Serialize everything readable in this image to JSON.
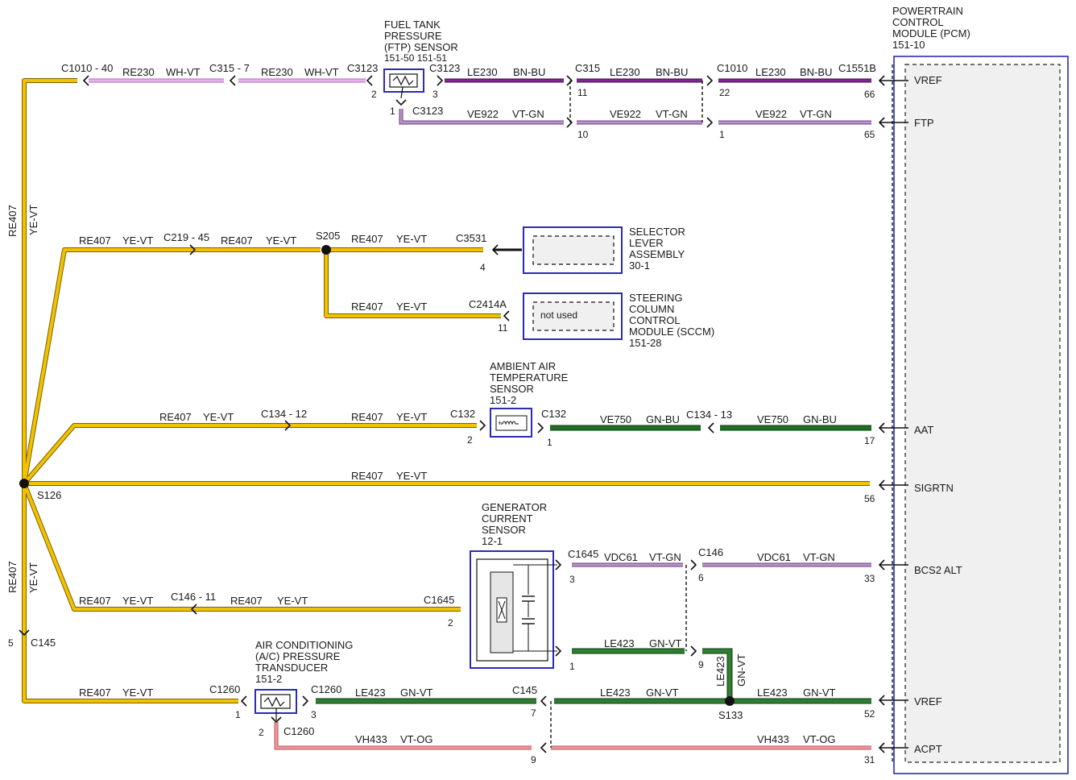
{
  "pcm": {
    "name_lines": [
      "POWERTRAIN",
      "CONTROL",
      "MODULE (PCM)",
      "151-10"
    ],
    "signals": {
      "vref1": {
        "name": "VREF",
        "pin": "66"
      },
      "ftp": {
        "name": "FTP",
        "pin": "65"
      },
      "aat": {
        "name": "AAT",
        "pin": "17"
      },
      "sigrtn": {
        "name": "SIGRTN",
        "pin": "56"
      },
      "bcs2alt": {
        "name": "BCS2 ALT",
        "pin": "33"
      },
      "vref2": {
        "name": "VREF",
        "pin": "52"
      },
      "acpt": {
        "name": "ACPT",
        "pin": "31"
      }
    }
  },
  "components": {
    "ftp_sensor": {
      "name_lines": [
        "FUEL TANK",
        "PRESSURE",
        "(FTP) SENSOR"
      ],
      "ref": "151-50  151-51"
    },
    "selector": {
      "name_lines": [
        "SELECTOR",
        "LEVER",
        "ASSEMBLY",
        "30-1"
      ]
    },
    "sccm": {
      "name_lines": [
        "STEERING",
        "COLUMN",
        "CONTROL",
        "MODULE (SCCM)",
        "151-28"
      ],
      "inner_text": "not used"
    },
    "aat_sensor": {
      "name_lines": [
        "AMBIENT AIR",
        "TEMPERATURE",
        "SENSOR",
        "151-2"
      ]
    },
    "gen_sensor": {
      "name_lines": [
        "GENERATOR",
        "CURRENT",
        "SENSOR",
        "12-1"
      ]
    },
    "ac_transducer": {
      "name_lines": [
        "AIR CONDITIONING",
        "(A/C) PRESSURE",
        "TRANSDUCER",
        "151-2"
      ]
    }
  },
  "splices": {
    "s126": "S126",
    "s205": "S205",
    "s133": "S133"
  },
  "colors": {
    "ye_vt": "#f2c200",
    "wh_vt": "#e0a4e6",
    "bn_bu": "#6b1f78",
    "vt_gn": "#a57bbd",
    "gn_bu": "#1f6e24",
    "gn_vt": "#2f7d32",
    "vt_og": "#f1979b",
    "pcm_border": "#2b2bb4",
    "component_border": "#2b2bb4"
  },
  "wire_labels": {
    "ftp_vref": {
      "c1010_40": "C1010 - 40",
      "c315_7": "C315 - 7",
      "c3123_a": "C3123",
      "c3123_b": "C3123",
      "w1_circuit": "RE230",
      "w1_color": "WH-VT",
      "w2_circuit": "RE230",
      "w2_color": "WH-VT",
      "pin2": "2",
      "pin3": "3",
      "w3_circuit": "LE230",
      "w3_color": "BN-BU",
      "c315": "C315",
      "pin11": "11",
      "w4_circuit": "LE230",
      "w4_color": "BN-BU",
      "c1010": "C1010",
      "pin22": "22",
      "w5_circuit": "LE230",
      "w5_color": "BN-BU",
      "c1551b": "C1551B"
    },
    "ftp_sig": {
      "c3123_c": "C3123",
      "pin1": "1",
      "w1_circuit": "VE922",
      "w1_color": "VT-GN",
      "pin10": "10",
      "w2_circuit": "VE922",
      "w2_color": "VT-GN",
      "pin1b": "1",
      "w3_circuit": "VE922",
      "w3_color": "VT-GN"
    },
    "left_bus": {
      "top_circuit": "RE407",
      "top_color": "YE-VT",
      "bot_circuit": "RE407",
      "bot_color": "YE-VT"
    },
    "selector_branch": {
      "w1_circuit": "RE407",
      "w1_color": "YE-VT",
      "c219_45": "C219 - 45",
      "w2_circuit": "RE407",
      "w2_color": "YE-VT",
      "w3_circuit": "RE407",
      "w3_color": "YE-VT",
      "c3531": "C3531",
      "pin4": "4"
    },
    "sccm_branch": {
      "w_circuit": "RE407",
      "w_color": "YE-VT",
      "c2414a": "C2414A",
      "pin11": "11"
    },
    "aat_branch": {
      "w1_circuit": "RE407",
      "w1_color": "YE-VT",
      "c134_12": "C134 - 12",
      "w2_circuit": "RE407",
      "w2_color": "YE-VT",
      "c132_a": "C132",
      "pin2": "2",
      "c132_b": "C132",
      "pin1": "1",
      "w3_circuit": "VE750",
      "w3_color": "GN-BU",
      "c134_13": "C134 - 13",
      "w4_circuit": "VE750",
      "w4_color": "GN-BU"
    },
    "sigrtn_branch": {
      "w_circuit": "RE407",
      "w_color": "YE-VT"
    },
    "gen_branch": {
      "w1_circuit": "RE407",
      "w1_color": "YE-VT",
      "c146_11": "C146 - 11",
      "w2_circuit": "RE407",
      "w2_color": "YE-VT",
      "c1645_a": "C1645",
      "pin2": "2",
      "c1645_b": "C1645",
      "pin3": "3",
      "w3_circuit": "VDC61",
      "w3_color": "VT-GN",
      "c146": "C146",
      "pin6": "6",
      "w4_circuit": "VDC61",
      "w4_color": "VT-GN",
      "pin1": "1",
      "w5_circuit": "LE423",
      "w5_color": "GN-VT",
      "pin9": "9",
      "v_circuit": "LE423",
      "v_color": "GN-VT"
    },
    "ac_branch": {
      "pin5": "5",
      "c145_a": "C145",
      "w1_circuit": "RE407",
      "w1_color": "YE-VT",
      "c1260_a": "C1260",
      "pin1": "1",
      "c1260_b": "C1260",
      "pin3": "3",
      "w2_circuit": "LE423",
      "w2_color": "GN-VT",
      "c145_b": "C145",
      "pin7": "7",
      "w3_circuit": "LE423",
      "w3_color": "GN-VT",
      "w4_circuit": "LE423",
      "w4_color": "GN-VT",
      "pin2": "2",
      "c1260_c": "C1260",
      "w5_circuit": "VH433",
      "w5_color": "VT-OG",
      "pin9": "9",
      "w6_circuit": "VH433",
      "w6_color": "VT-OG"
    }
  }
}
